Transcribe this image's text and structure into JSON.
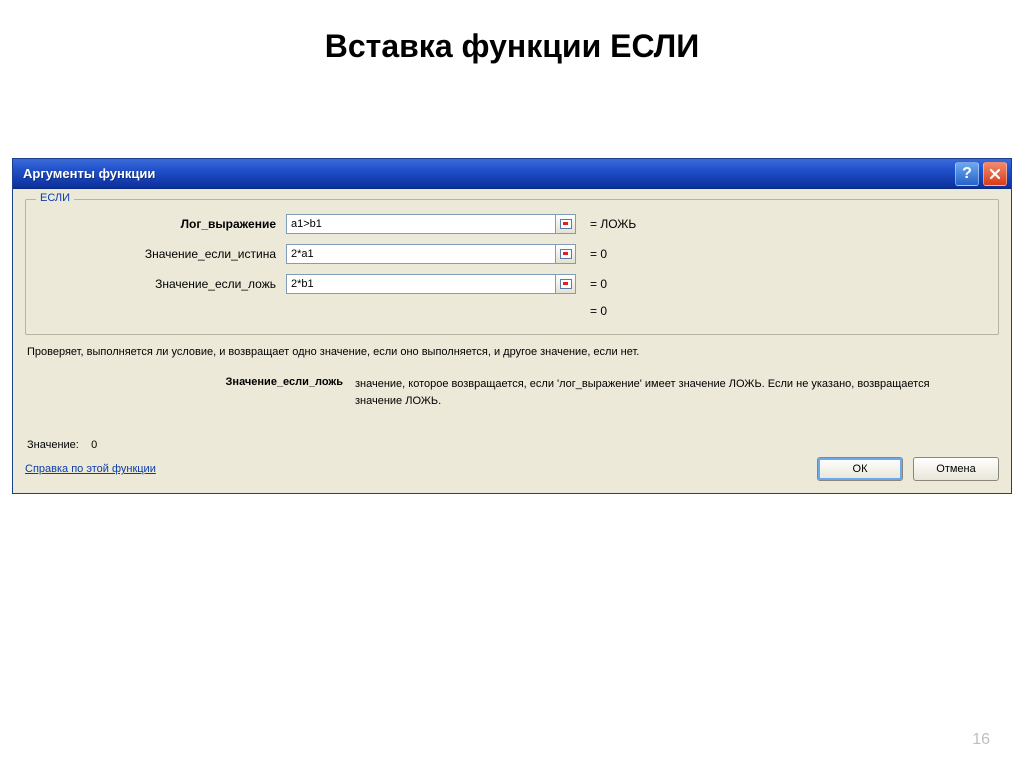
{
  "slide": {
    "title": "Вставка функции ЕСЛИ",
    "page_number": "16"
  },
  "dialog": {
    "title": "Аргументы функции",
    "function_name": "ЕСЛИ",
    "args": [
      {
        "label": "Лог_выражение",
        "bold": true,
        "value": "a1>b1",
        "result": "= ЛОЖЬ"
      },
      {
        "label": "Значение_если_истина",
        "bold": false,
        "value": "2*a1",
        "result": "= 0"
      },
      {
        "label": "Значение_если_ложь",
        "bold": false,
        "value": "2*b1",
        "result": "= 0"
      }
    ],
    "overall_result": "= 0",
    "description": "Проверяет, выполняется ли условие, и возвращает одно значение, если оно выполняется, и другое значение, если нет.",
    "arg_explain_label": "Значение_если_ложь",
    "arg_explain_text": "значение, которое возвращается, если 'лог_выражение' имеет значение ЛОЖЬ. Если не указано, возвращается значение ЛОЖЬ.",
    "value_label": "Значение:",
    "value_result": "0",
    "help_link": "Справка по этой функции",
    "ok_label": "ОК",
    "cancel_label": "Отмена"
  }
}
